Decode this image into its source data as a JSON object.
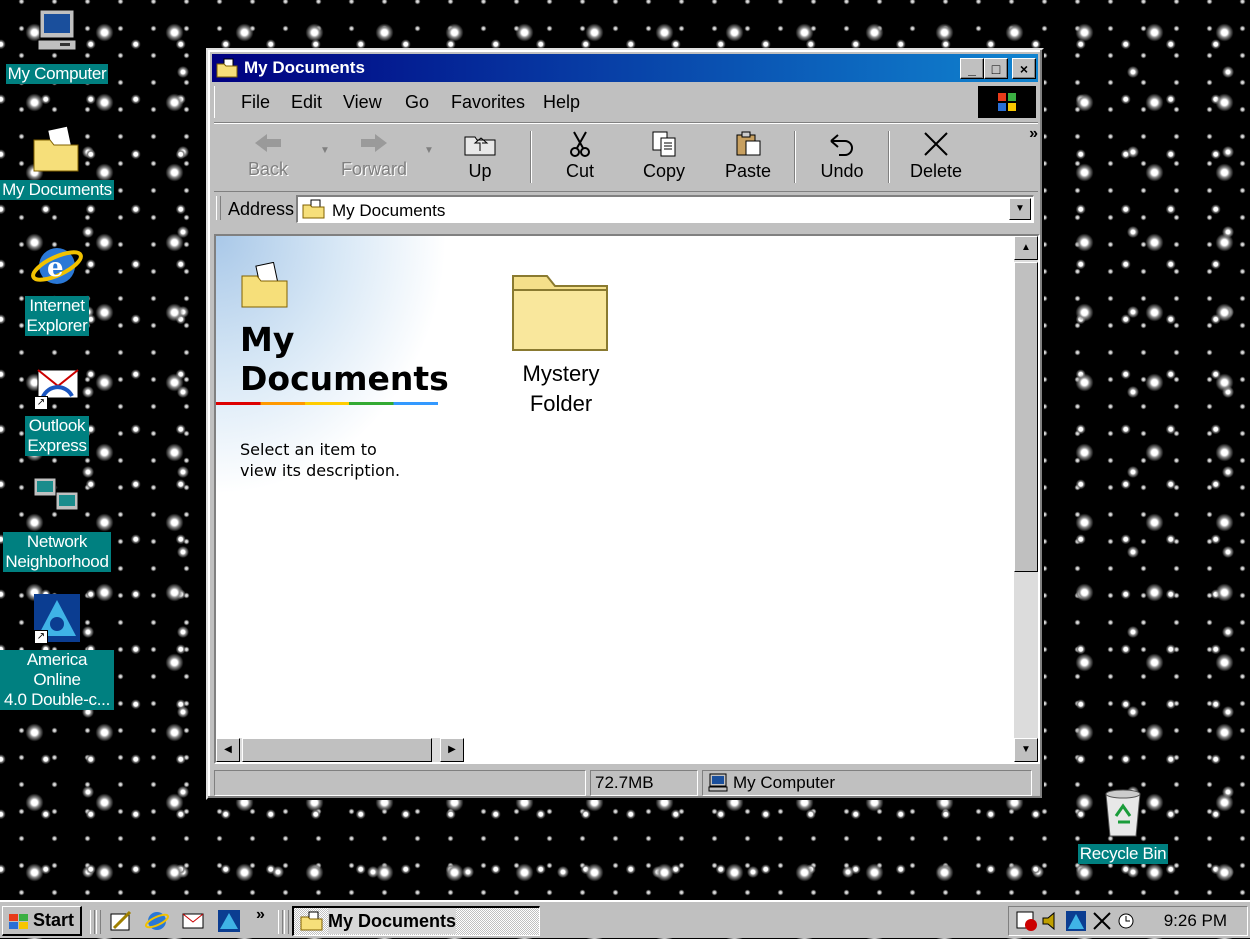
{
  "desktop": {
    "icons": [
      {
        "label_lines": [
          "My Computer"
        ]
      },
      {
        "label_lines": [
          "My Documents"
        ]
      },
      {
        "label_lines": [
          "Internet",
          "Explorer"
        ]
      },
      {
        "label_lines": [
          "Outlook",
          "Express"
        ]
      },
      {
        "label_lines": [
          "Network",
          "Neighborhood"
        ]
      },
      {
        "label_lines": [
          "America Online",
          "4.0 Double-c..."
        ]
      }
    ],
    "recycle_bin": {
      "label": "Recycle Bin"
    }
  },
  "window": {
    "title": "My Documents",
    "controls": {
      "minimize": "_",
      "maximize": "□",
      "close": "×"
    },
    "menu": [
      "File",
      "Edit",
      "View",
      "Go",
      "Favorites",
      "Help"
    ],
    "toolbar": {
      "back": "Back",
      "forward": "Forward",
      "up": "Up",
      "cut": "Cut",
      "copy": "Copy",
      "paste": "Paste",
      "undo": "Undo",
      "delete": "Delete",
      "more": "»"
    },
    "address": {
      "label": "Address",
      "value": "My Documents"
    },
    "webview": {
      "title_line1": "My",
      "title_line2": "Documents",
      "description": "Select an item to view its description."
    },
    "items": [
      {
        "label_line1": "Mystery",
        "label_line2": "Folder",
        "icon": "folder-icon"
      }
    ],
    "status": {
      "size": "72.7MB",
      "zone": "My Computer"
    }
  },
  "taskbar": {
    "start_label": "Start",
    "more": "»",
    "task_title": "My Documents",
    "clock": "9:26 PM"
  },
  "colors": {
    "title_active": "#000080",
    "desktop_label_bg": "#008080",
    "face": "#c0c0c0"
  }
}
